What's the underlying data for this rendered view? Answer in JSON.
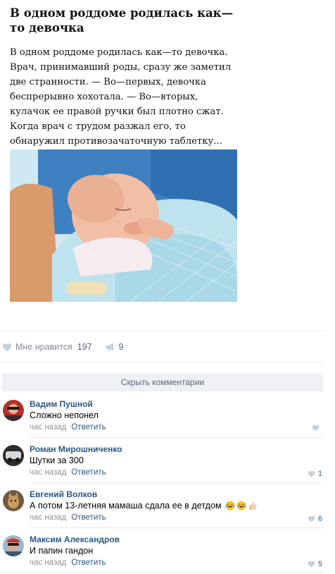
{
  "post": {
    "title": "В одном роддоме родилась как—то девочка",
    "text": "В одном роддоме родилась как—то девочка. Врач, принимавший роды, сразу же заметил две странности. — Во—первых, девочка беспрерывно хохотала. — Во—вторых, кулачок ее правой ручки был плотно сжат. Когда врач с трудом разжал его, то обнаружил противозачаточную таблетку..."
  },
  "actions": {
    "like_label": "Мне нравится",
    "like_count": "197",
    "share_count": "9"
  },
  "hide_comments_label": "Скрыть комментарии",
  "comments": [
    {
      "author": "Вадим Пушной",
      "text": "Сложно непонел",
      "time": "час назад",
      "reply": "Ответить",
      "likes": "",
      "emojis": []
    },
    {
      "author": "Роман Мирошниченко",
      "text": "Шутки за 300",
      "time": "час назад",
      "reply": "Ответить",
      "likes": "1",
      "emojis": []
    },
    {
      "author": "Евгений Волков",
      "text": "А потом 13-летняя мамаша сдала ее в детдом",
      "time": "час назад",
      "reply": "Ответить",
      "likes": "6",
      "emojis": [
        "laughing-tears-emoji",
        "laughing-tears-emoji",
        "thumbs-up-emoji"
      ]
    },
    {
      "author": "Максим Александров",
      "text": "И папин гандон",
      "time": "час назад",
      "reply": "Ответить",
      "likes": "5",
      "emojis": []
    }
  ],
  "colors": {
    "link": "#2a5885",
    "meta": "#939393",
    "like_icon": "#c5d0db",
    "button_bg": "#eef0f3"
  }
}
